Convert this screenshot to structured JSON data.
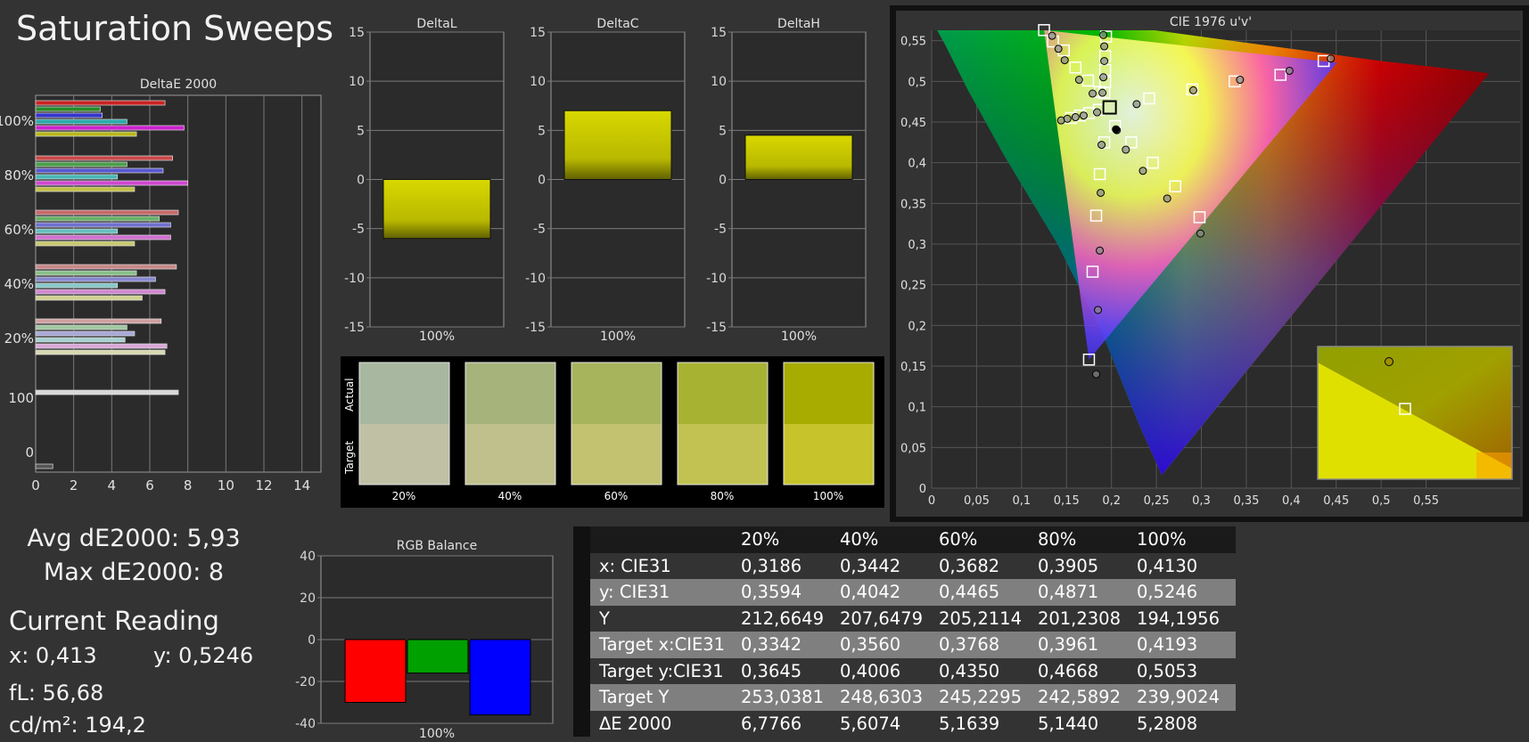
{
  "title": "Saturation Sweeps",
  "stats": {
    "avg": "Avg dE2000: 5,93",
    "max": "Max dE2000: 8"
  },
  "current_reading": {
    "title": "Current Reading",
    "x": "x: 0,413",
    "y": "y: 0,5246",
    "fl": "fL: 56,68",
    "cdm2": "cd/m²: 194,2"
  },
  "colors": {
    "accent_yellow": "#c8c800",
    "red": "#ff0000",
    "green": "#00a000",
    "blue": "#0000ff"
  },
  "chart_data": [
    {
      "type": "bar",
      "title": "DeltaE 2000",
      "orientation": "horizontal",
      "xlim": [
        0,
        15
      ],
      "x_ticks": [
        "0",
        "2",
        "4",
        "6",
        "8",
        "10",
        "12",
        "14"
      ],
      "groups": [
        "100%",
        "80%",
        "60%",
        "40%",
        "20%",
        "100",
        "0"
      ],
      "group_bars": [
        [
          {
            "v": 6.8,
            "c": "#cc2222"
          },
          {
            "v": 3.4,
            "c": "#2a8a2a"
          },
          {
            "v": 3.5,
            "c": "#3333cc"
          },
          {
            "v": 4.8,
            "c": "#2aaaaa"
          },
          {
            "v": 7.8,
            "c": "#cc22cc"
          },
          {
            "v": 5.3,
            "c": "#b8b820"
          }
        ],
        [
          {
            "v": 7.2,
            "c": "#c84848"
          },
          {
            "v": 4.8,
            "c": "#4aa04a"
          },
          {
            "v": 6.7,
            "c": "#5858d0"
          },
          {
            "v": 4.3,
            "c": "#48b8b8"
          },
          {
            "v": 8.0,
            "c": "#d048d0"
          },
          {
            "v": 5.2,
            "c": "#c0c048"
          }
        ],
        [
          {
            "v": 7.5,
            "c": "#c86868"
          },
          {
            "v": 6.5,
            "c": "#68b068"
          },
          {
            "v": 7.1,
            "c": "#7070d0"
          },
          {
            "v": 4.3,
            "c": "#68c0c0"
          },
          {
            "v": 7.1,
            "c": "#d070d0"
          },
          {
            "v": 5.2,
            "c": "#c8c870"
          }
        ],
        [
          {
            "v": 7.4,
            "c": "#c88888"
          },
          {
            "v": 5.3,
            "c": "#88c088"
          },
          {
            "v": 6.3,
            "c": "#8888d0"
          },
          {
            "v": 4.3,
            "c": "#88c8c8"
          },
          {
            "v": 6.8,
            "c": "#d088d0"
          },
          {
            "v": 5.6,
            "c": "#d0d090"
          }
        ],
        [
          {
            "v": 6.6,
            "c": "#d0a0a0"
          },
          {
            "v": 4.8,
            "c": "#a0c8a0"
          },
          {
            "v": 5.2,
            "c": "#a8a8d8"
          },
          {
            "v": 4.7,
            "c": "#a8d0d0"
          },
          {
            "v": 6.9,
            "c": "#d8a8d8"
          },
          {
            "v": 6.8,
            "c": "#d8d8b0"
          }
        ],
        [
          {
            "v": 7.5,
            "c": "#d8d8d8"
          }
        ],
        [
          {
            "v": 0.9,
            "c": "#555555"
          }
        ]
      ]
    },
    {
      "type": "bar",
      "panels": [
        {
          "title": "DeltaL",
          "category": "100%",
          "value": -6
        },
        {
          "title": "DeltaC",
          "category": "100%",
          "value": 7
        },
        {
          "title": "DeltaH",
          "category": "100%",
          "value": 4.5
        }
      ],
      "ylim": [
        -15,
        15
      ],
      "y_ticks": [
        "15",
        "10",
        "5",
        "0",
        "-5",
        "-10",
        "-15"
      ]
    },
    {
      "type": "bar",
      "title": "RGB Balance",
      "category": "100%",
      "series": [
        {
          "color": "#ff0000",
          "value": -30
        },
        {
          "color": "#00a000",
          "value": -16
        },
        {
          "color": "#0000ff",
          "value": -36
        }
      ],
      "ylim": [
        -40,
        40
      ],
      "y_ticks": [
        "40",
        "20",
        "0",
        "-20",
        "-40"
      ]
    },
    {
      "type": "scatter",
      "title": "CIE 1976 u'v'",
      "xlim": [
        0,
        0.6
      ],
      "ylim": [
        0,
        0.6
      ],
      "x_ticks": [
        "0",
        "0,05",
        "0,1",
        "0,15",
        "0,2",
        "0,25",
        "0,3",
        "0,35",
        "0,4",
        "0,45",
        "0,5",
        "0,55"
      ],
      "y_ticks": [
        "0",
        "0,05",
        "0,1",
        "0,15",
        "0,2",
        "0,25",
        "0,3",
        "0,35",
        "0,4",
        "0,45",
        "0,5",
        "0,55"
      ],
      "gamut_triangle": [
        [
          0.451,
          0.523
        ],
        [
          0.125,
          0.563
        ],
        [
          0.175,
          0.158
        ]
      ],
      "white_point": [
        0.198,
        0.468
      ],
      "targets": [
        [
          0.436,
          0.525
        ],
        [
          0.388,
          0.508
        ],
        [
          0.337,
          0.5
        ],
        [
          0.29,
          0.49
        ],
        [
          0.242,
          0.479
        ],
        [
          0.135,
          0.549
        ],
        [
          0.147,
          0.538
        ],
        [
          0.16,
          0.517
        ],
        [
          0.174,
          0.501
        ],
        [
          0.187,
          0.487
        ],
        [
          0.125,
          0.563
        ],
        [
          0.155,
          0.455
        ],
        [
          0.165,
          0.458
        ],
        [
          0.175,
          0.461
        ],
        [
          0.186,
          0.465
        ],
        [
          0.175,
          0.158
        ],
        [
          0.179,
          0.266
        ],
        [
          0.183,
          0.335
        ],
        [
          0.187,
          0.386
        ],
        [
          0.192,
          0.425
        ],
        [
          0.298,
          0.333
        ],
        [
          0.271,
          0.371
        ],
        [
          0.246,
          0.4
        ],
        [
          0.222,
          0.425
        ],
        [
          0.204,
          0.445
        ],
        [
          0.194,
          0.555
        ],
        [
          0.193,
          0.531
        ],
        [
          0.193,
          0.514
        ],
        [
          0.193,
          0.499
        ],
        [
          0.192,
          0.486
        ]
      ],
      "measured": [
        [
          0.444,
          0.528
        ],
        [
          0.398,
          0.513
        ],
        [
          0.343,
          0.502
        ],
        [
          0.291,
          0.489
        ],
        [
          0.228,
          0.472
        ],
        [
          0.134,
          0.556
        ],
        [
          0.141,
          0.54
        ],
        [
          0.148,
          0.526
        ],
        [
          0.164,
          0.502
        ],
        [
          0.179,
          0.485
        ],
        [
          0.144,
          0.452
        ],
        [
          0.151,
          0.454
        ],
        [
          0.16,
          0.456
        ],
        [
          0.169,
          0.458
        ],
        [
          0.184,
          0.462
        ],
        [
          0.183,
          0.14
        ],
        [
          0.185,
          0.219
        ],
        [
          0.187,
          0.292
        ],
        [
          0.188,
          0.363
        ],
        [
          0.189,
          0.422
        ],
        [
          0.299,
          0.313
        ],
        [
          0.262,
          0.356
        ],
        [
          0.235,
          0.39
        ],
        [
          0.216,
          0.416
        ],
        [
          0.206,
          0.44
        ],
        [
          0.191,
          0.557
        ],
        [
          0.192,
          0.543
        ],
        [
          0.192,
          0.525
        ],
        [
          0.191,
          0.505
        ],
        [
          0.19,
          0.486
        ]
      ],
      "current": [
        0.205,
        0.441
      ]
    }
  ],
  "swatches": {
    "labels": [
      "20%",
      "40%",
      "60%",
      "80%",
      "100%"
    ],
    "actual_label": "Actual",
    "target_label": "Target",
    "actual": [
      "#a8b8a0",
      "#a6b47c",
      "#a8b45c",
      "#a8b232",
      "#a8ac00"
    ],
    "target": [
      "#c0c0a4",
      "#c0c08c",
      "#c2c270",
      "#c2c252",
      "#c6c42a"
    ]
  },
  "table": {
    "columns": [
      "20%",
      "40%",
      "60%",
      "80%",
      "100%"
    ],
    "rows": [
      {
        "label": "x: CIE31",
        "values": [
          "0,3186",
          "0,3442",
          "0,3682",
          "0,3905",
          "0,4130"
        ]
      },
      {
        "label": "y: CIE31",
        "values": [
          "0,3594",
          "0,4042",
          "0,4465",
          "0,4871",
          "0,5246"
        ]
      },
      {
        "label": "Y",
        "values": [
          "212,6649",
          "207,6479",
          "205,2114",
          "201,2308",
          "194,1956"
        ]
      },
      {
        "label": "Target x:CIE31",
        "values": [
          "0,3342",
          "0,3560",
          "0,3768",
          "0,3961",
          "0,4193"
        ]
      },
      {
        "label": "Target y:CIE31",
        "values": [
          "0,3645",
          "0,4006",
          "0,4350",
          "0,4668",
          "0,5053"
        ]
      },
      {
        "label": "Target Y",
        "values": [
          "253,0381",
          "248,6303",
          "245,2295",
          "242,5892",
          "239,9024"
        ]
      },
      {
        "label": "ΔE 2000",
        "values": [
          "6,7766",
          "5,6074",
          "5,1639",
          "5,1440",
          "5,2808"
        ]
      }
    ]
  }
}
